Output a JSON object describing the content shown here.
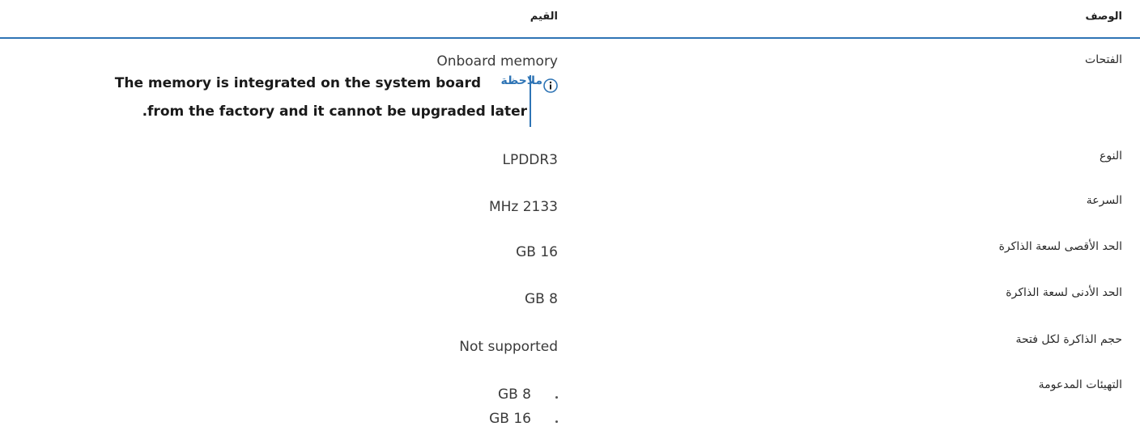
{
  "table": {
    "header": {
      "description": "الوصف",
      "values": "القيم"
    },
    "rows": [
      {
        "label": "الفتحات",
        "value": "Onboard memory",
        "note": {
          "label": "ملاحظة",
          "line1": "The memory is integrated on the system board",
          "line2": ".from the factory and it cannot be upgraded later"
        }
      },
      {
        "label": "النوع",
        "value": "LPDDR3"
      },
      {
        "label": "السرعة",
        "value": "MHz 2133"
      },
      {
        "label": "الحد الأقصى لسعة الذاكرة",
        "value": "GB 16"
      },
      {
        "label": "الحد الأدنى لسعة الذاكرة",
        "value": "GB 8"
      },
      {
        "label": "حجم الذاكرة لكل فتحة",
        "value": "Not supported"
      },
      {
        "label": "التهيئات المدعومة",
        "items": [
          "GB 8",
          "GB 16"
        ]
      }
    ]
  },
  "colors": {
    "accent": "#2e74b5",
    "text": "#1f1f1f"
  },
  "icons": {
    "note": "info-circle-icon"
  }
}
